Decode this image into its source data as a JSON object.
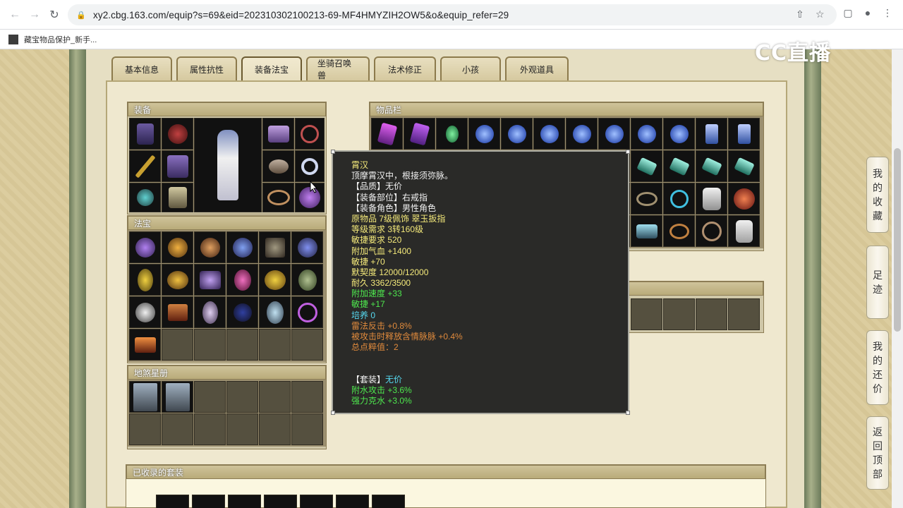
{
  "browser": {
    "url": "xy2.cbg.163.com/equip?s=69&eid=202310302100213-69-MF4HMYZIH2OW5&o&equip_refer=29",
    "bookmark": "藏宝物品保护_新手..."
  },
  "logo": "CC直播",
  "tabs": [
    {
      "label": "基本信息"
    },
    {
      "label": "属性抗性"
    },
    {
      "label": "装备法宝"
    },
    {
      "label": "坐骑召唤兽"
    },
    {
      "label": "法术修正"
    },
    {
      "label": "小孩"
    },
    {
      "label": "外观道具"
    }
  ],
  "sections": {
    "equipment": "装备",
    "fabao": "法宝",
    "dimai": "地煞星册",
    "inventory": "物品栏",
    "collected_sets": "已收录的套装"
  },
  "tooltip": {
    "name": "霄汉",
    "desc": "顶摩霄汉中，根接须弥脉。",
    "quality": "【品质】无价",
    "slot": "【装备部位】右戒指",
    "role": "【装备角色】男性角色",
    "original": "原物品 7级佩饰 翠玉扳指",
    "level_req": "等级需求 3转160级",
    "agi_req": "敏捷要求 520",
    "hp": "附加气血 +1400",
    "agi": "敏捷 +70",
    "tacit": "默契度 12000/12000",
    "durability": "耐久 3362/3500",
    "speed": "附加速度 +33",
    "agi2": "敏捷 +17",
    "cultivate": "培养 0",
    "thunder": "雷法反击 +0.8%",
    "hidden": "被攻击时释放含情脉脉 +0.4%",
    "total": "总点粹值：2",
    "set_label": "【套装】",
    "set_value": "无价",
    "water_attack": "附水攻击 +3.6%",
    "water_restrain": "强力克水 +3.0%"
  },
  "float": {
    "fav": [
      "我",
      "的",
      "收",
      "藏"
    ],
    "foot": [
      "足",
      "迹"
    ],
    "bargain": [
      "我",
      "的",
      "还",
      "价"
    ],
    "top": [
      "返",
      "回",
      "顶",
      "部"
    ]
  }
}
